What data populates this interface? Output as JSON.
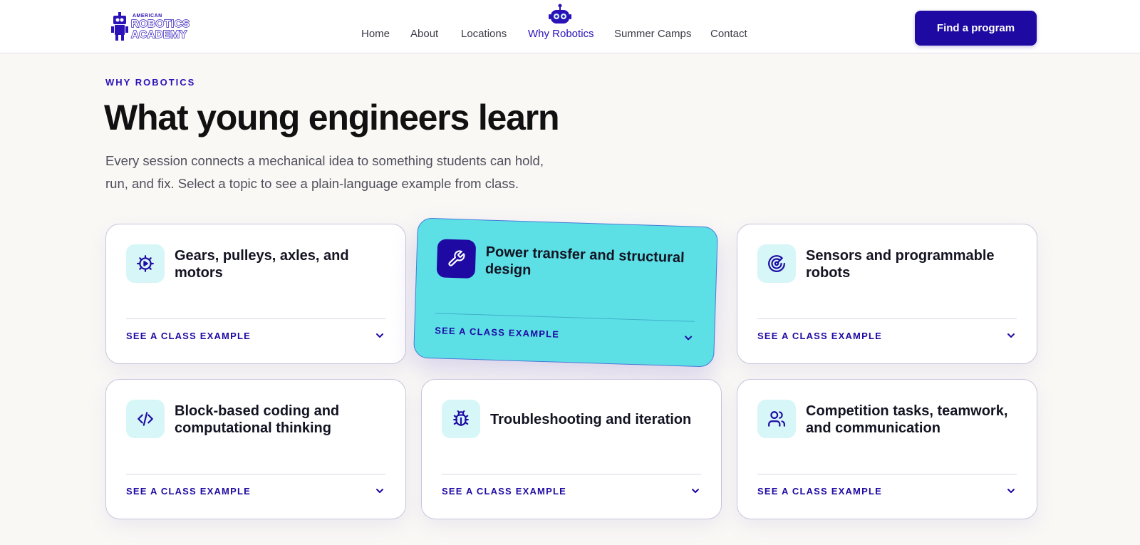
{
  "brand": {
    "logo_small": "AMERICAN",
    "logo_line1": "ROBOTICS",
    "logo_line2": "ACADEMY"
  },
  "nav": {
    "items": [
      {
        "label": "Home"
      },
      {
        "label": "About"
      },
      {
        "label": "Locations"
      },
      {
        "label": "Why Robotics",
        "active": true
      },
      {
        "label": "Summer Camps"
      },
      {
        "label": "Contact"
      }
    ],
    "cta_label": "Find a program"
  },
  "intro": {
    "eyebrow": "WHY ROBOTICS",
    "title": "What young engineers learn",
    "description": "Every session connects a mechanical idea to something students can hold, run, and fix. Select a topic to see a plain-language example from class."
  },
  "cards": [
    {
      "title": "Gears, pulleys, axles, and motors",
      "icon": "gear-play-icon",
      "link": "SEE A CLASS EXAMPLE"
    },
    {
      "title": "Power transfer and structural design",
      "icon": "wrench-icon",
      "link": "SEE A CLASS EXAMPLE",
      "active": true
    },
    {
      "title": "Sensors and programmable robots",
      "icon": "radar-icon",
      "link": "SEE A CLASS EXAMPLE"
    },
    {
      "title": "Block-based coding and computational thinking",
      "icon": "code-icon",
      "link": "SEE A CLASS EXAMPLE"
    },
    {
      "title": "Troubleshooting and iteration",
      "icon": "bug-icon",
      "link": "SEE A CLASS EXAMPLE"
    },
    {
      "title": "Competition tasks, teamwork, and communication",
      "icon": "users-icon",
      "link": "SEE A CLASS EXAMPLE"
    }
  ],
  "colors": {
    "accent": "#1e0aa3",
    "accent_text": "#2a12b8",
    "active_card": "#5ce0e6",
    "icon_tile": "#d6f6f8",
    "page_background": "#faf8f5"
  }
}
